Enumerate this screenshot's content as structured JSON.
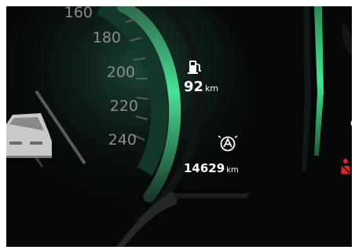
{
  "speedometer": {
    "ticks": [
      "160",
      "180",
      "200",
      "220",
      "240"
    ]
  },
  "range": {
    "icon": "fuel-pump-icon",
    "value": "92",
    "unit": "km"
  },
  "odometer": {
    "icon": "auto-a-icon",
    "value": "14629",
    "unit": "km"
  },
  "indicators": {
    "seatbelt_icon": "seatbelt-warning-icon",
    "car_icon": "car-silhouette-icon",
    "edge_text": "C"
  },
  "colors": {
    "background": "#060808",
    "accent_green": "#3de68e",
    "warning_red": "#e0242a",
    "tick_grey": "#8c8c8c"
  }
}
